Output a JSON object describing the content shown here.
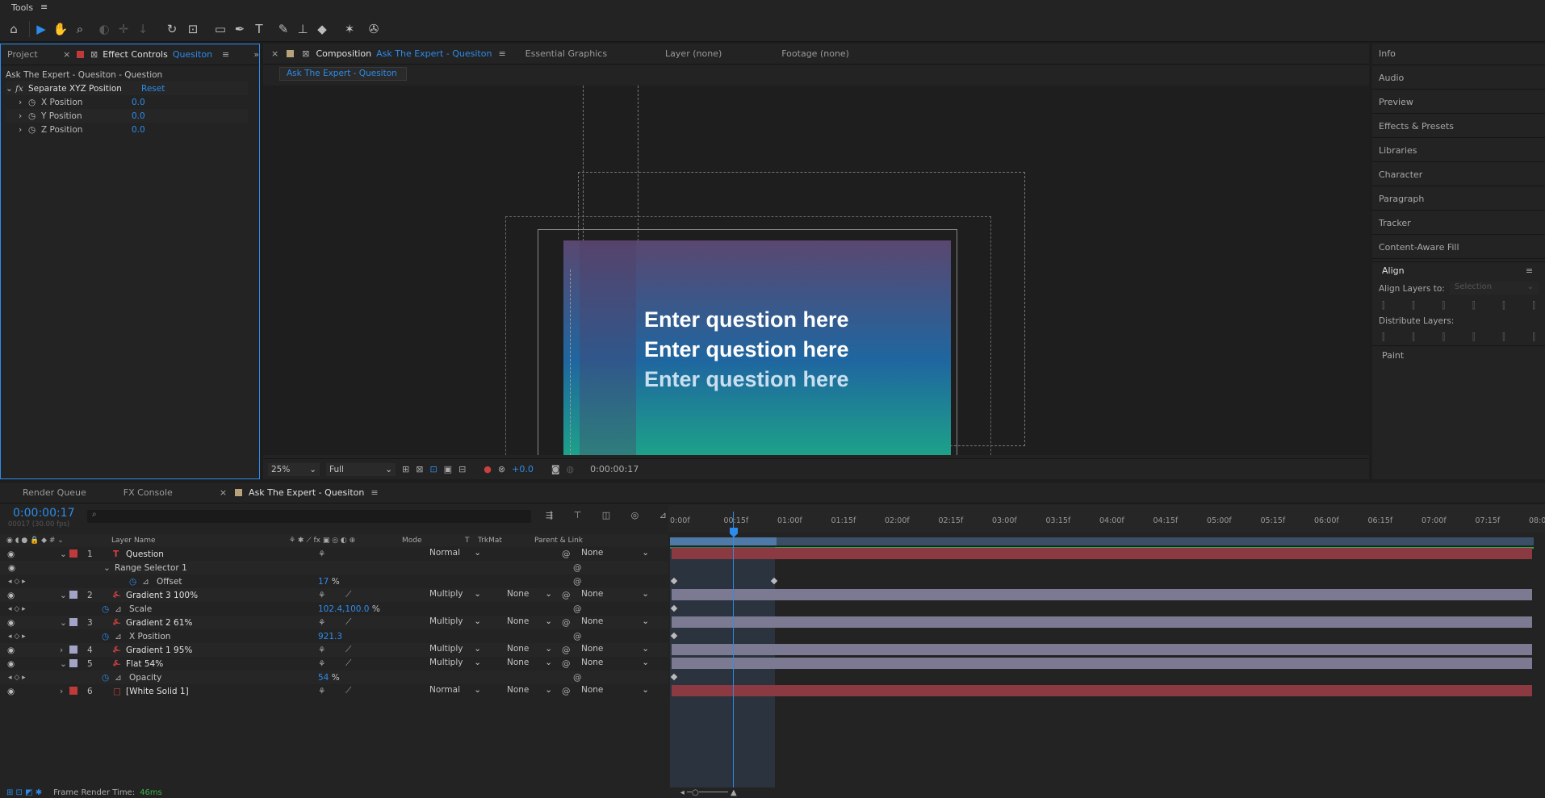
{
  "menu": {
    "tools": "Tools",
    "menu_icon": "≡"
  },
  "left_panel": {
    "tab_project": "Project",
    "tab_effect_controls": "Effect Controls",
    "tab_effect_target": "Quesiton",
    "breadcrumb": "Ask The Expert - Quesiton - Question",
    "effect_name": "Separate XYZ Position",
    "reset": "Reset",
    "props": [
      {
        "label": "X Position",
        "value": "0.0"
      },
      {
        "label": "Y Position",
        "value": "0.0"
      },
      {
        "label": "Z Position",
        "value": "0.0"
      }
    ]
  },
  "comp": {
    "tab_label": "Composition",
    "tab_name": "Ask The Expert - Quesiton",
    "tab_essential": "Essential Graphics",
    "tab_layer": "Layer (none)",
    "tab_footage": "Footage (none)",
    "sub_tab": "Ask The Expert - Quesiton",
    "lines": [
      "Enter question here",
      "Enter question here",
      "Enter question here"
    ],
    "zoom": "25%",
    "resolution": "Full",
    "exposure": "+0.0",
    "timecode": "0:00:00:17",
    "colors": {
      "gradient_top": "#5a4770",
      "gradient_mid": "#1f66a0",
      "gradient_bottom": "#1da388"
    }
  },
  "right_panel": {
    "items": [
      "Info",
      "Audio",
      "Preview",
      "Effects & Presets",
      "Libraries",
      "Character",
      "Paragraph",
      "Tracker",
      "Content-Aware Fill"
    ],
    "align_title": "Align",
    "align_layers_to": "Align Layers to:",
    "align_select": "Selection",
    "distribute": "Distribute Layers:",
    "paint": "Paint"
  },
  "timeline": {
    "tabs": [
      "Render Queue",
      "FX Console",
      "Ask The Expert - Quesiton"
    ],
    "timecode": "0:00:00:17",
    "fps": "00017 (30.00 fps)",
    "col_layer_name": "Layer Name",
    "col_mode": "Mode",
    "col_t": "T",
    "col_trkmat": "TrkMat",
    "col_parent": "Parent & Link",
    "ruler": [
      "0:00f",
      "00:15f",
      "01:00f",
      "01:15f",
      "02:00f",
      "02:15f",
      "03:00f",
      "03:15f",
      "04:00f",
      "04:15f",
      "05:00f",
      "05:15f",
      "06:00f",
      "06:15f",
      "07:00f",
      "07:15f",
      "08:0"
    ],
    "rows": [
      {
        "num": "1",
        "name": "Question",
        "value": "",
        "mode": "Normal",
        "trk": "",
        "parent": "None",
        "color": "#c0393b"
      },
      {
        "num": "",
        "name": "Range Selector 1",
        "value": "",
        "mode": "",
        "trk": "",
        "parent": ""
      },
      {
        "num": "",
        "name": "Offset",
        "value": "17",
        "unit": "%",
        "mode": "",
        "trk": "",
        "parent": ""
      },
      {
        "num": "2",
        "name": "Gradient 3 100%",
        "value": "",
        "mode": "Multiply",
        "trk": "None",
        "parent": "None",
        "color": "#a3a3c8"
      },
      {
        "num": "",
        "name": "Scale",
        "value": "102.4,100.0",
        "unit": "%",
        "mode": "",
        "trk": "",
        "parent": ""
      },
      {
        "num": "3",
        "name": "Gradient 2 61%",
        "value": "",
        "mode": "Multiply",
        "trk": "None",
        "parent": "None",
        "color": "#a3a3c8"
      },
      {
        "num": "",
        "name": "X Position",
        "value": "921.3",
        "unit": "",
        "mode": "",
        "trk": "",
        "parent": ""
      },
      {
        "num": "4",
        "name": "Gradient 1 95%",
        "value": "",
        "mode": "Multiply",
        "trk": "None",
        "parent": "None",
        "color": "#a3a3c8"
      },
      {
        "num": "5",
        "name": "Flat 54%",
        "value": "",
        "mode": "Multiply",
        "trk": "None",
        "parent": "None",
        "color": "#a3a3c8"
      },
      {
        "num": "",
        "name": "Opacity",
        "value": "54",
        "unit": "%",
        "mode": "",
        "trk": "",
        "parent": ""
      },
      {
        "num": "6",
        "name": "[White Solid 1]",
        "value": "",
        "mode": "Normal",
        "trk": "None",
        "parent": "None",
        "color": "#c0393b"
      }
    ],
    "render_label": "Frame Render Time:",
    "render_value": "46ms"
  }
}
